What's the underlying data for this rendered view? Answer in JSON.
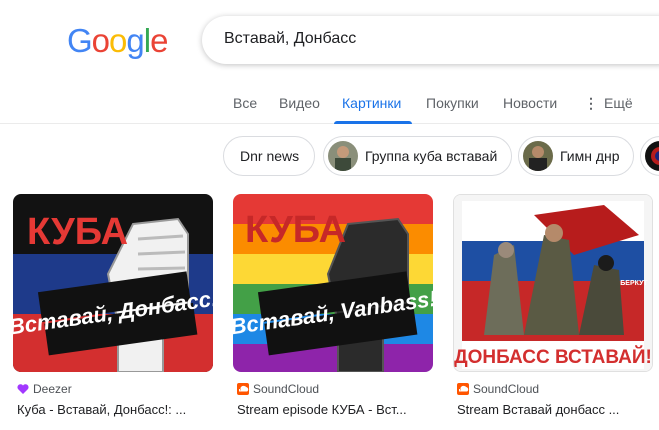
{
  "logo": {
    "letters": [
      "G",
      "o",
      "o",
      "g",
      "l",
      "e"
    ],
    "colors": [
      "#4285f4",
      "#ea4335",
      "#fbbc05",
      "#4285f4",
      "#34a853",
      "#ea4335"
    ]
  },
  "search": {
    "query": "Вставай, Донбасс"
  },
  "tabs": [
    {
      "label": "Все"
    },
    {
      "label": "Видео"
    },
    {
      "label": "Картинки",
      "active": true
    },
    {
      "label": "Покупки"
    },
    {
      "label": "Новости"
    },
    {
      "label": "Ещё"
    }
  ],
  "chips": [
    {
      "label": "Dnr news"
    },
    {
      "label": "Группа куба вставай"
    },
    {
      "label": "Гимн днр"
    }
  ],
  "results": [
    {
      "image_text_top": "КУБА",
      "image_text_main": "Вставай, Донбасс!",
      "source": "Deezer",
      "title": "Куба - Вставай, Донбасс!: ..."
    },
    {
      "image_text_top": "КУБА",
      "image_text_main": "Вставай, Vanbass!",
      "source": "SoundCloud",
      "title": "Stream episode КУБА - Вст..."
    },
    {
      "image_text_top": "БЕРКУТ",
      "image_text_main": "ДОНБАСС ВСТАВАЙ!",
      "source": "SoundCloud",
      "title": "Stream Вставай донбасс ..."
    }
  ],
  "colors": {
    "accent": "#1a73e8",
    "deezer": "#a238ff",
    "soundcloud": "#ff5500"
  }
}
